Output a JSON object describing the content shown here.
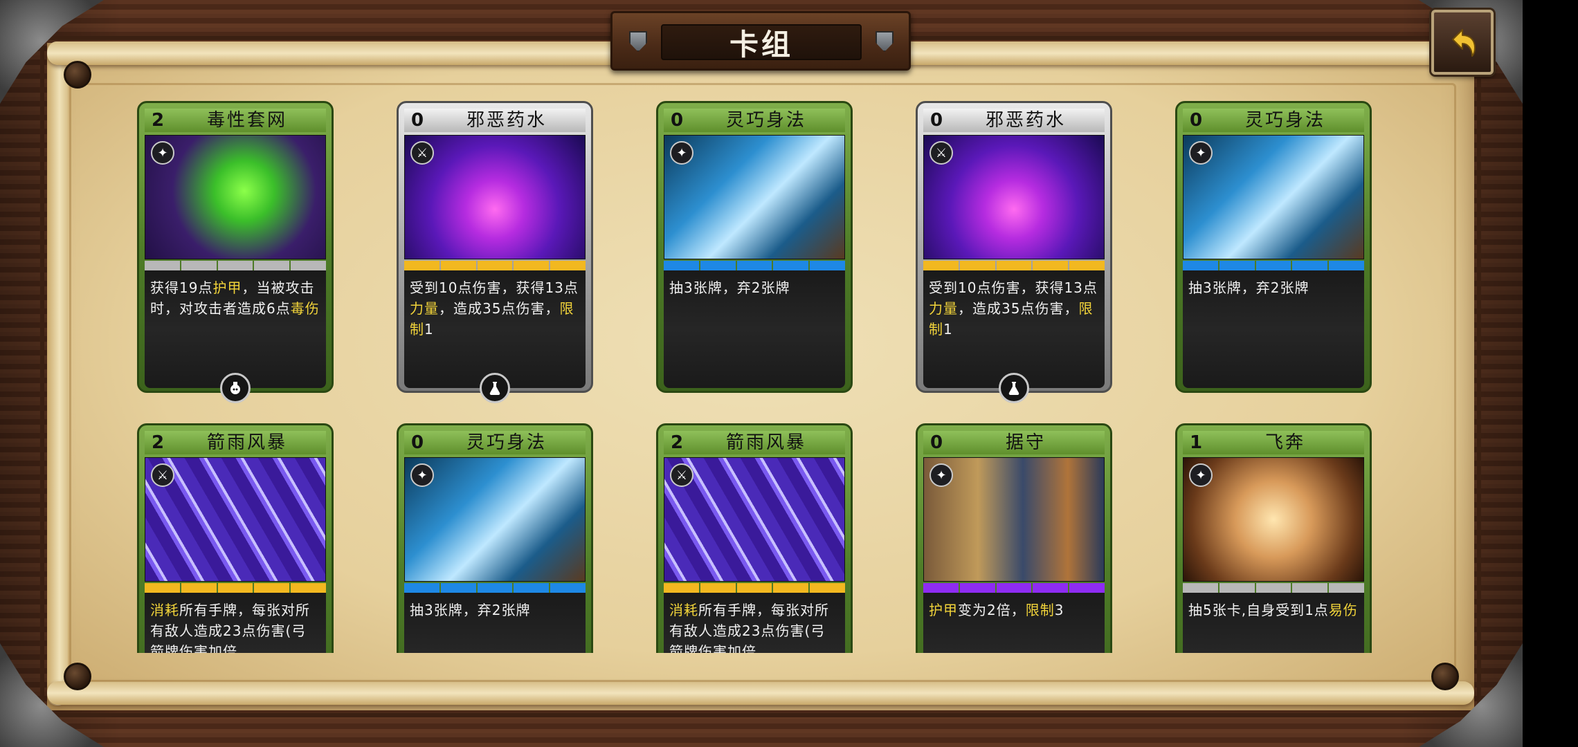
{
  "title": "卡组",
  "back_button_label": "",
  "cards": [
    {
      "cost": "2",
      "name": "毒性套网",
      "frame": "green",
      "type_icon": "sparkle-icon",
      "rarity": "#b8b8b8",
      "art": "poison-net",
      "desc": [
        {
          "t": "获得19点"
        },
        {
          "t": "护甲",
          "k": 1
        },
        {
          "t": "，当被攻击时，对攻击者造成6点"
        },
        {
          "t": "毒伤",
          "k": 1
        }
      ],
      "badge": "potion-icon"
    },
    {
      "cost": "0",
      "name": "邪恶药水",
      "frame": "silver",
      "type_icon": "sword-icon",
      "rarity": "#f2b820",
      "art": "evil-potion",
      "desc": [
        {
          "t": "受到10点伤害，获得13点"
        },
        {
          "t": "力量",
          "k": 1
        },
        {
          "t": "，造成35点伤害，"
        },
        {
          "t": "限制",
          "k": 1
        },
        {
          "t": "1"
        }
      ],
      "badge": "flask-icon"
    },
    {
      "cost": "0",
      "name": "灵巧身法",
      "frame": "green",
      "type_icon": "sparkle-icon",
      "rarity": "#1e88e5",
      "art": "agile",
      "desc": [
        {
          "t": "抽3张牌，弃2张牌"
        }
      ],
      "badge": ""
    },
    {
      "cost": "0",
      "name": "邪恶药水",
      "frame": "silver",
      "type_icon": "sword-icon",
      "rarity": "#f2b820",
      "art": "evil-potion",
      "desc": [
        {
          "t": "受到10点伤害，获得13点"
        },
        {
          "t": "力量",
          "k": 1
        },
        {
          "t": "，造成35点伤害，"
        },
        {
          "t": "限制",
          "k": 1
        },
        {
          "t": "1"
        }
      ],
      "badge": "flask-icon"
    },
    {
      "cost": "0",
      "name": "灵巧身法",
      "frame": "green",
      "type_icon": "sparkle-icon",
      "rarity": "#1e88e5",
      "art": "agile",
      "desc": [
        {
          "t": "抽3张牌，弃2张牌"
        }
      ],
      "badge": ""
    },
    {
      "cost": "2",
      "name": "箭雨风暴",
      "frame": "green",
      "type_icon": "sword-icon",
      "rarity": "#f2b820",
      "art": "arrows",
      "desc": [
        {
          "t": "消耗",
          "k": 1
        },
        {
          "t": "所有手牌，每张对所有敌人造成23点伤害(弓箭牌伤害加倍"
        }
      ],
      "badge": ""
    },
    {
      "cost": "0",
      "name": "灵巧身法",
      "frame": "green",
      "type_icon": "sparkle-icon",
      "rarity": "#1e88e5",
      "art": "agile",
      "desc": [
        {
          "t": "抽3张牌，弃2张牌"
        }
      ],
      "badge": ""
    },
    {
      "cost": "2",
      "name": "箭雨风暴",
      "frame": "green",
      "type_icon": "sword-icon",
      "rarity": "#f2b820",
      "art": "arrows",
      "desc": [
        {
          "t": "消耗",
          "k": 1
        },
        {
          "t": "所有手牌，每张对所有敌人造成23点伤害(弓箭牌伤害加倍"
        }
      ],
      "badge": ""
    },
    {
      "cost": "0",
      "name": "据守",
      "frame": "green",
      "type_icon": "sparkle-icon",
      "rarity": "#8e2cf2",
      "art": "guard",
      "desc": [
        {
          "t": "护甲",
          "k": 1
        },
        {
          "t": "变为2倍，"
        },
        {
          "t": "限制",
          "k": 1
        },
        {
          "t": "3"
        }
      ],
      "badge": ""
    },
    {
      "cost": "1",
      "name": "飞奔",
      "frame": "green",
      "type_icon": "sparkle-icon",
      "rarity": "#b8b8b8",
      "art": "dash",
      "desc": [
        {
          "t": "抽5张卡,自身受到1点"
        },
        {
          "t": "易伤",
          "k": 1
        }
      ],
      "badge": ""
    }
  ]
}
